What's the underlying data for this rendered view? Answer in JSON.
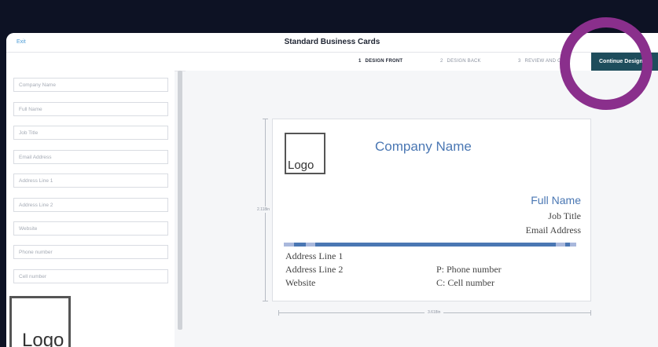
{
  "header": {
    "exit_label": "Exit",
    "title": "Standard Business Cards",
    "continue_label": "Continue Design",
    "continue_arrow": "→"
  },
  "steps": [
    {
      "num": "1",
      "label": "DESIGN FRONT",
      "active": true
    },
    {
      "num": "2",
      "label": "DESIGN BACK",
      "active": false
    },
    {
      "num": "3",
      "label": "REVIEW AND OR",
      "active": false
    }
  ],
  "fields": [
    {
      "placeholder": "Company Name"
    },
    {
      "placeholder": "Full Name"
    },
    {
      "placeholder": "Job Title"
    },
    {
      "placeholder": "Email Address"
    },
    {
      "placeholder": "Address Line 1"
    },
    {
      "placeholder": "Address Line 2"
    },
    {
      "placeholder": "Website"
    },
    {
      "placeholder": "Phone number"
    },
    {
      "placeholder": "Cell number"
    }
  ],
  "logo_thumb_label": "Logo",
  "card": {
    "logo_label": "Logo",
    "company": "Company Name",
    "full_name": "Full Name",
    "job_title": "Job Title",
    "email": "Email Address",
    "address1": "Address Line 1",
    "address2": "Address Line 2",
    "website": "Website",
    "phone": "P: Phone number",
    "cell": "C: Cell number"
  },
  "dimensions": {
    "height": "2.118in",
    "width": "3.618in"
  },
  "colors": {
    "accent": "#4a77b3",
    "continue_bg": "#1e4d5c",
    "highlight_ring": "#8a2f8c"
  }
}
